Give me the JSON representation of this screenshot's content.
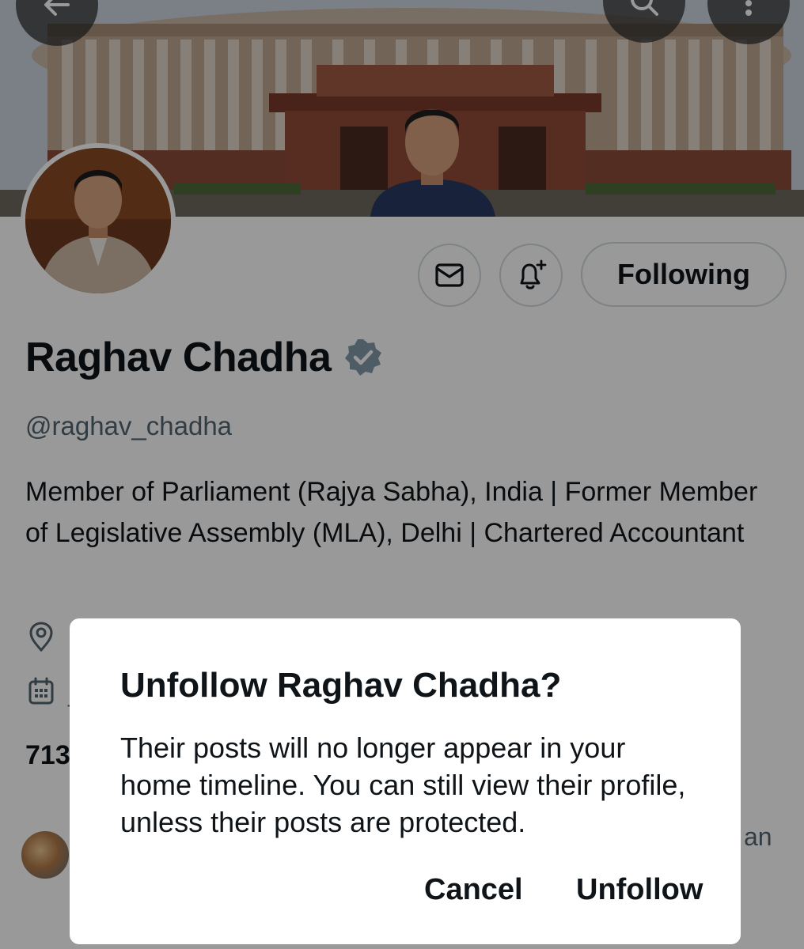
{
  "header": {
    "back_icon": "arrow-left-icon",
    "search_icon": "search-icon",
    "more_icon": "more-vertical-icon"
  },
  "actions": {
    "message_icon": "mail-icon",
    "notify_icon": "bell-plus-icon",
    "following_label": "Following"
  },
  "profile": {
    "name": "Raghav Chadha",
    "verified_icon": "verified-badge-icon",
    "handle": "@raghav_chadha",
    "bio": "Member of Parliament (Rajya Sabha), India | Former Member of Legislative Assembly (MLA), Delhi | Chartered Accountant",
    "location_icon": "location-pin-icon",
    "joined_icon": "calendar-icon",
    "following_count_fragment": "713",
    "followed_by_fragment": "an"
  },
  "dialog": {
    "title": "Unfollow Raghav Chadha?",
    "body": "Their posts will no longer appear in your home timeline. You can still view their profile, unless their posts are protected.",
    "cancel_label": "Cancel",
    "confirm_label": "Unfollow"
  },
  "colors": {
    "text_primary": "#0f1419",
    "text_secondary": "#536471",
    "border": "#cfd9de",
    "overlay": "rgba(0,0,0,0.4)"
  }
}
